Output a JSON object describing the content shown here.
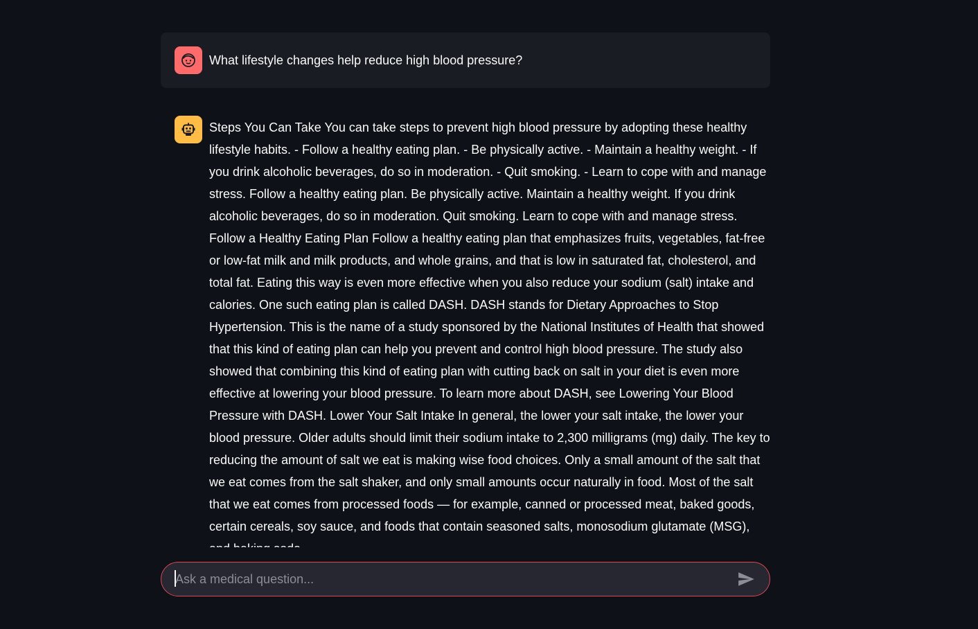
{
  "chat": {
    "messages": [
      {
        "role": "user",
        "avatar_icon": "user-face-icon",
        "avatar_color": "#ff6b6b",
        "text": "What lifestyle changes help reduce high blood pressure?"
      },
      {
        "role": "assistant",
        "avatar_icon": "robot-icon",
        "avatar_color": "#ffbd45",
        "text": "Steps You Can Take You can take steps to prevent high blood pressure by adopting these healthy lifestyle habits. - Follow a healthy eating plan. - Be physically active. - Maintain a healthy weight. - If you drink alcoholic beverages, do so in moderation. - Quit smoking. - Learn to cope with and manage stress. Follow a healthy eating plan. Be physically active. Maintain a healthy weight. If you drink alcoholic beverages, do so in moderation. Quit smoking. Learn to cope with and manage stress. Follow a Healthy Eating Plan Follow a healthy eating plan that emphasizes fruits, vegetables, fat-free or low-fat milk and milk products, and whole grains, and that is low in saturated fat, cholesterol, and total fat. Eating this way is even more effective when you also reduce your sodium (salt) intake and calories. One such eating plan is called DASH. DASH stands for Dietary Approaches to Stop Hypertension. This is the name of a study sponsored by the National Institutes of Health that showed that this kind of eating plan can help you prevent and control high blood pressure. The study also showed that combining this kind of eating plan with cutting back on salt in your diet is even more effective at lowering your blood pressure. To learn more about DASH, see Lowering Your Blood Pressure with DASH. Lower Your Salt Intake In general, the lower your salt intake, the lower your blood pressure. Older adults should limit their sodium intake to 2,300 milligrams (mg) daily. The key to reducing the amount of salt we eat is making wise food choices. Only a small amount of the salt that we eat comes from the salt shaker, and only small amounts occur naturally in food. Most of the salt that we eat comes from processed foods — for example, canned or processed meat, baked goods, certain cereals, soy sauce, and foods that contain seasoned salts, monosodium glutamate (MSG), and baking soda."
      }
    ]
  },
  "input": {
    "placeholder": "Ask a medical question...",
    "value": "",
    "send_icon": "send-icon",
    "border_color": "#e0464e"
  },
  "theme": {
    "background": "#0e1117",
    "user_bubble": "#1a1c24",
    "input_background": "#262730"
  }
}
